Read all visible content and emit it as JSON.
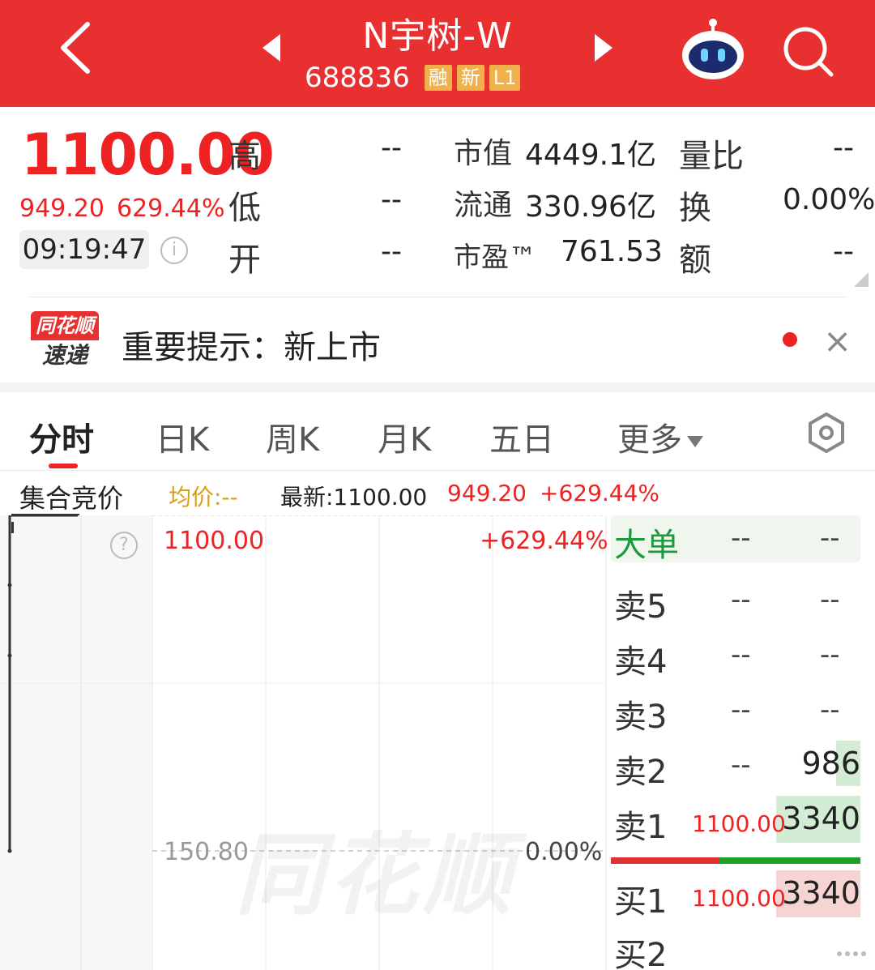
{
  "header": {
    "title": "N宇树-W",
    "code": "688836",
    "tags": [
      "融",
      "新",
      "L1"
    ]
  },
  "quote": {
    "price": "1100.00",
    "change": "949.20",
    "change_pct": "629.44%",
    "time": "09:19:47",
    "info_glyph": "i",
    "stats": [
      {
        "label": "高",
        "value": "--"
      },
      {
        "label": "低",
        "value": "--"
      },
      {
        "label": "开",
        "value": "--"
      },
      {
        "label": "市值",
        "value": "4449.1亿"
      },
      {
        "label": "流通",
        "value": "330.96亿"
      },
      {
        "label": "市盈™",
        "value": "761.53"
      },
      {
        "label": "量比",
        "value": "--"
      },
      {
        "label": "换",
        "value": "0.00%"
      },
      {
        "label": "额",
        "value": "--"
      }
    ]
  },
  "notice": {
    "logo_top": "同花顺",
    "logo_bottom": "速递",
    "text": "重要提示：新上市",
    "close": "×"
  },
  "tabs": [
    "分时",
    "日K",
    "周K",
    "月K",
    "五日",
    "更多"
  ],
  "chart_header": {
    "mode": "集合竞价",
    "avg": "均价:--",
    "latest": "最新:1100.00",
    "change": "949.20",
    "change_pct": "+629.44%"
  },
  "chart": {
    "top_price": "1100.00",
    "top_pct": "+629.44%",
    "base_price": "150.80",
    "base_pct": "0.00%",
    "help_glyph": "?",
    "watermark": "同花顺"
  },
  "orderbook": {
    "big_order": {
      "label": "大单",
      "a": "--",
      "b": "--"
    },
    "asks": [
      {
        "label": "卖5",
        "price": "--",
        "vol": "--"
      },
      {
        "label": "卖4",
        "price": "--",
        "vol": "--"
      },
      {
        "label": "卖3",
        "price": "--",
        "vol": "--"
      },
      {
        "label": "卖2",
        "price": "--",
        "vol": "986"
      },
      {
        "label": "卖1",
        "price": "1100.00",
        "vol": "3340"
      }
    ],
    "bids": [
      {
        "label": "买1",
        "price": "1100.00",
        "vol": "3340"
      },
      {
        "label": "买2",
        "price": "",
        "vol": ""
      }
    ]
  },
  "colors": {
    "header": "#e93030",
    "up": "#e22222",
    "down": "#20a020",
    "avg": "#d4a017"
  }
}
